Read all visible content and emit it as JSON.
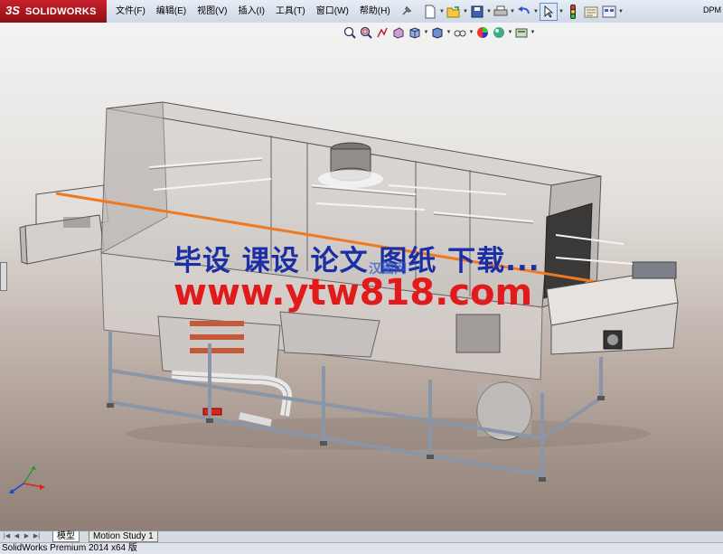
{
  "app": {
    "logo_mark": "3S",
    "logo_text": "SOLIDWORKS",
    "right_label": "DPM"
  },
  "menu": [
    {
      "label": "文件(F)"
    },
    {
      "label": "编辑(E)"
    },
    {
      "label": "视图(V)"
    },
    {
      "label": "插入(I)"
    },
    {
      "label": "工具(T)"
    },
    {
      "label": "窗口(W)"
    },
    {
      "label": "帮助(H)"
    }
  ],
  "toolbar": {
    "icons": [
      "new-document-icon",
      "open-icon",
      "save-icon",
      "print-icon",
      "undo-icon",
      "select-icon",
      "rebuild-icon",
      "options-icon",
      "customize-icon"
    ]
  },
  "headsup": {
    "icons": [
      "zoom-to-fit-icon",
      "zoom-to-area-icon",
      "previous-view-icon",
      "section-view-icon",
      "view-orientation-icon",
      "display-style-icon",
      "hide-show-items-icon",
      "edit-appearance-icon",
      "apply-scene-icon",
      "view-settings-icon"
    ]
  },
  "watermark": {
    "line1": "毕设 课设 论文 图纸 下载...",
    "line2": "www.ytw818.com",
    "logo": "汉图网"
  },
  "tabs": [
    {
      "label": "模型",
      "active": true
    },
    {
      "label": "Motion Study 1",
      "active": false
    }
  ],
  "status": {
    "text": "SolidWorks Premium 2014 x64 版"
  },
  "colors": {
    "brand": "#c8202a",
    "watermark_blue": "#1a2fa5",
    "watermark_red": "#e11b1b",
    "accent_line": "#f07820"
  }
}
